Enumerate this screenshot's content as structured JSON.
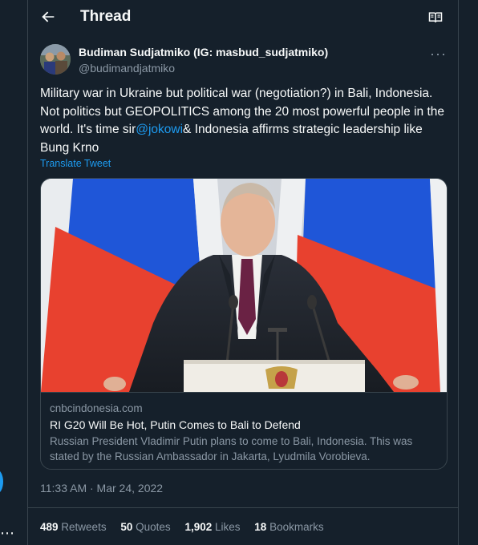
{
  "header": {
    "title": "Thread",
    "back_icon": "arrow-left-icon",
    "reader_icon": "book-open-icon"
  },
  "author": {
    "name": "Budiman Sudjatmiko (IG: masbud_sudjatmiko)",
    "handle": "@budimandjatmiko"
  },
  "tweet": {
    "text_before_mention": "Military war in Ukraine but political war (negotiation?) in Bali, Indonesia. Not politics but GEOPOLITICS among the 20 most powerful people in the world. It's time sir",
    "mention": "@jokowi",
    "text_after_mention": "& Indonesia affirms strategic leadership like Bung Krno",
    "translate_label": "Translate Tweet"
  },
  "card": {
    "domain": "cnbcindonesia.com",
    "title": "RI G20 Will Be Hot, Putin Comes to Bali to Defend",
    "description": "Russian President Vladimir Putin plans to come to Bali, Indonesia. This was stated by the Russian Ambassador in Jakarta, Lyudmila Vorobieva."
  },
  "meta": {
    "timestamp": "11:33 AM · Mar 24, 2022"
  },
  "stats": {
    "retweets_count": "489",
    "retweets_label": "Retweets",
    "quotes_count": "50",
    "quotes_label": "Quotes",
    "likes_count": "1,902",
    "likes_label": "Likes",
    "bookmarks_count": "18",
    "bookmarks_label": "Bookmarks"
  },
  "colors": {
    "background": "#15202b",
    "accent": "#1d9bf0",
    "secondary_text": "#8b98a5",
    "border": "#38444d"
  }
}
